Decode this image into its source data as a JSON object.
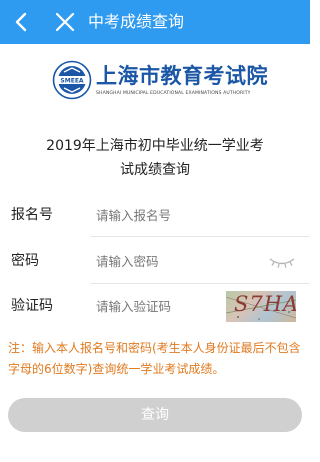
{
  "header": {
    "title": "中考成绩查询",
    "bg_color": "#2f9bf0"
  },
  "logo": {
    "name_cn": "上海市教育考试院",
    "name_en": "SHANGHAI MUNICIPAL EDUCATIONAL EXAMINATIONS AUTHORITY",
    "seal_text": "SMEEA"
  },
  "heading": {
    "line1": "2019年上海市初中毕业统一学业考",
    "line2": "试成绩查询"
  },
  "form": {
    "reg_label": "报名号",
    "reg_placeholder": "请输入报名号",
    "pwd_label": "密码",
    "pwd_placeholder": "请输入密码",
    "captcha_label": "验证码",
    "captcha_placeholder": "请输入验证码",
    "captcha_image_text": "S7HA"
  },
  "note": "注：输入本人报名号和密码(考生本人身份证最后不包含字母的6位数字)查询统一学业考试成绩。",
  "submit_label": "查询",
  "colors": {
    "note": "#e07a1f",
    "brand": "#1b57a6",
    "button_disabled": "#d0d0d0"
  }
}
